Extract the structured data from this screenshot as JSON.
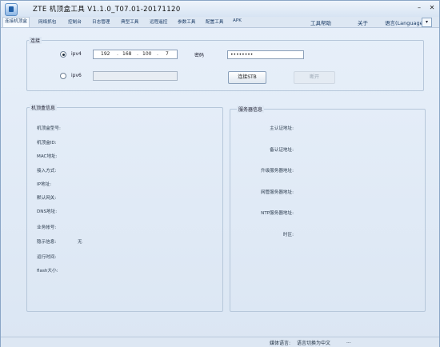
{
  "window": {
    "title": "ZTE 机顶盒工具 V1.1.0_T07.01-20171120",
    "min": "–",
    "close": "✕"
  },
  "menu": [
    "连接机顶盒",
    "网络抓包",
    "控制台",
    "日志管理",
    "典型工具",
    "远程遥控",
    "参数工具",
    "配置工具",
    "APK"
  ],
  "menu_right": {
    "help": "工具帮助",
    "about": "关于",
    "language": "语言(Language)",
    "lang_arrow": "▾"
  },
  "connect": {
    "group_title": "连接",
    "ipv4_label": "ipv4",
    "ip_segments": [
      "192",
      "168",
      "100",
      "7"
    ],
    "ipv6_label": "ipv6",
    "password_label": "密码",
    "password_value": "••••••••",
    "connect_button": "连接STB",
    "disconnect_button": "断开"
  },
  "stb_info": {
    "group_title": "机顶盒信息",
    "fields": [
      {
        "label": "机顶盒型号:",
        "value": ""
      },
      {
        "label": "机顶盒ID:",
        "value": ""
      },
      {
        "label": "MAC地址:",
        "value": ""
      },
      {
        "label": "接入方式:",
        "value": ""
      },
      {
        "label": "IP地址:",
        "value": ""
      },
      {
        "label": "默认网关:",
        "value": ""
      },
      {
        "label": "DNS地址:",
        "value": ""
      },
      {
        "label": "业务帐号:",
        "value": ""
      },
      {
        "label": "隐示信息:",
        "value": "无"
      },
      {
        "label": "运行时间:",
        "value": ""
      },
      {
        "label": "flash大小:",
        "value": ""
      }
    ]
  },
  "server_info": {
    "group_title": "服务器信息",
    "fields": [
      {
        "label": "主认证地址:"
      },
      {
        "label": "备认证地址:"
      },
      {
        "label": "升级服务器地址:"
      },
      {
        "label": "网管服务器地址:"
      },
      {
        "label": "NTP服务器地址:"
      },
      {
        "label": "时区:"
      }
    ]
  },
  "status": {
    "language_label": "媒体语言:",
    "language_value": "语言切换为中文",
    "extra": "..."
  }
}
